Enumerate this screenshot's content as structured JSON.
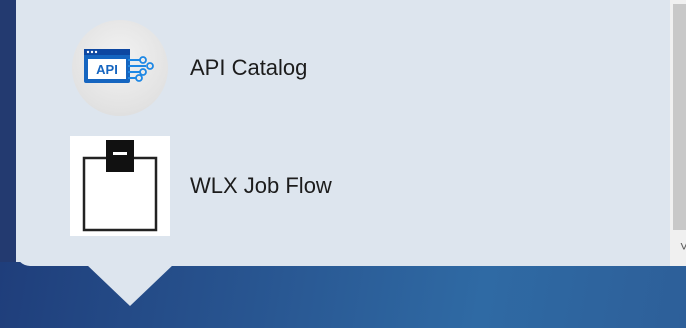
{
  "menu": {
    "items": [
      {
        "label": "API Catalog",
        "icon": "api-catalog-icon"
      },
      {
        "label": "WLX Job Flow",
        "icon": "clipboard-icon"
      }
    ]
  },
  "scrollbar": {
    "down_arrow": "˅"
  },
  "colors": {
    "popup_bg": "#dde5ee",
    "bottom_bar": "#2a5a95",
    "api_icon_blue": "#1565c0"
  }
}
